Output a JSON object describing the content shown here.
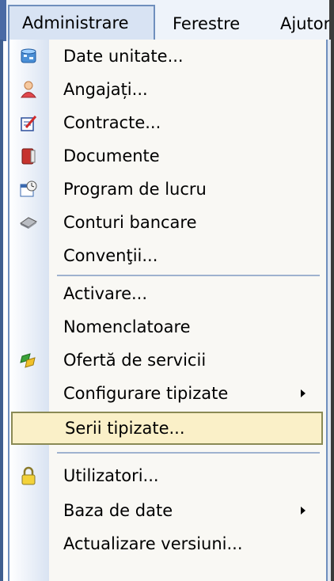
{
  "menubar": {
    "items": [
      {
        "label": "Administrare"
      },
      {
        "label": "Ferestre"
      },
      {
        "label": "Ajutor"
      }
    ]
  },
  "menu": {
    "items": [
      {
        "label": "Date unitate...",
        "icon": "database-icon"
      },
      {
        "label": "Angajați...",
        "icon": "person-icon"
      },
      {
        "label": "Contracte...",
        "icon": "contract-icon"
      },
      {
        "label": "Documente",
        "icon": "documents-icon"
      },
      {
        "label": "Program de lucru",
        "icon": "schedule-icon"
      },
      {
        "label": "Conturi bancare",
        "icon": "bank-card-icon"
      },
      {
        "label": "Convenţii...",
        "icon": ""
      },
      {
        "label": "Activare...",
        "icon": ""
      },
      {
        "label": "Nomenclatoare",
        "icon": ""
      },
      {
        "label": "Ofertă de servicii",
        "icon": "offer-icon"
      },
      {
        "label": "Configurare tipizate",
        "icon": "",
        "submenu": true
      },
      {
        "label": "Serii tipizate...",
        "icon": "",
        "highlighted": true
      },
      {
        "label": "Utilizatori...",
        "icon": "lock-icon"
      },
      {
        "label": "Baza de date",
        "icon": "",
        "submenu": true
      },
      {
        "label": "Actualizare versiuni...",
        "icon": ""
      }
    ]
  },
  "colors": {
    "menubar_bg": "#eef3fa",
    "menu_bg": "#f9f8f4",
    "highlight_bg": "#faf0c8",
    "highlight_border": "#8a8a55",
    "separator": "#9fb2cf"
  }
}
